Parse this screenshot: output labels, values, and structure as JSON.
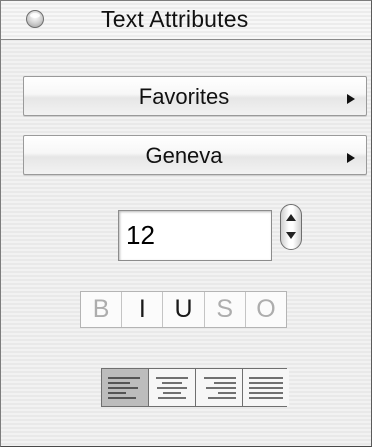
{
  "window": {
    "title": "Text Attributes"
  },
  "font_collection": {
    "selected": "Favorites"
  },
  "font_family": {
    "selected": "Geneva"
  },
  "font_size": {
    "value": "12"
  },
  "style_buttons": [
    {
      "label": "B",
      "name": "bold",
      "enabled": false
    },
    {
      "label": "I",
      "name": "italic",
      "enabled": true
    },
    {
      "label": "U",
      "name": "underline",
      "enabled": true
    },
    {
      "label": "S",
      "name": "strikethrough",
      "enabled": false
    },
    {
      "label": "O",
      "name": "outline",
      "enabled": false
    }
  ],
  "alignment_buttons": [
    {
      "name": "align-left",
      "icon": "align-left-icon",
      "selected": true
    },
    {
      "name": "align-center",
      "icon": "align-center-icon",
      "selected": false
    },
    {
      "name": "align-right",
      "icon": "align-right-icon",
      "selected": false
    },
    {
      "name": "align-justify",
      "icon": "align-justify-icon",
      "selected": false
    }
  ]
}
